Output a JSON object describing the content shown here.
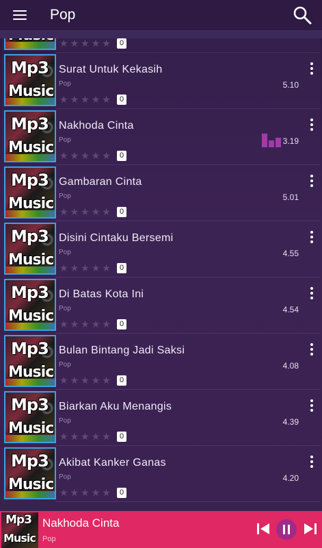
{
  "header": {
    "title": "Pop",
    "menu_icon": "hamburger-menu-icon",
    "search_icon": "search-icon"
  },
  "songs": [
    {
      "title": "",
      "genre": "",
      "duration": "",
      "rating_count": "0",
      "partial": true
    },
    {
      "title": "Surat Untuk Kekasih",
      "genre": "Pop",
      "duration": "5.10",
      "rating_count": "0"
    },
    {
      "title": "Nakhoda Cinta",
      "genre": "Pop",
      "duration": "3.19",
      "rating_count": "0",
      "playing": true
    },
    {
      "title": "Gambaran Cinta",
      "genre": "Pop",
      "duration": "5.01",
      "rating_count": "0"
    },
    {
      "title": "Disini Cintaku Bersemi",
      "genre": "Pop",
      "duration": "4.55",
      "rating_count": "0"
    },
    {
      "title": "Di Batas Kota Ini",
      "genre": "Pop",
      "duration": "4.54",
      "rating_count": "0"
    },
    {
      "title": "Bulan Bintang Jadi Saksi",
      "genre": "Pop",
      "duration": "4.08",
      "rating_count": "0"
    },
    {
      "title": "Biarkan Aku Menangis",
      "genre": "Pop",
      "duration": "4.39",
      "rating_count": "0"
    },
    {
      "title": "Akibat Kanker Ganas",
      "genre": "Pop",
      "duration": "4.20",
      "rating_count": "0"
    }
  ],
  "thumbnail": {
    "line1": "Mp3",
    "line2": "Music"
  },
  "player": {
    "title": "Nakhoda Cinta",
    "genre": "Pop",
    "state": "playing"
  },
  "colors": {
    "accent": "#e02865",
    "eq_bar": "#a33aa8",
    "pause_bg": "#a02a8a",
    "background": "#3b2254"
  }
}
